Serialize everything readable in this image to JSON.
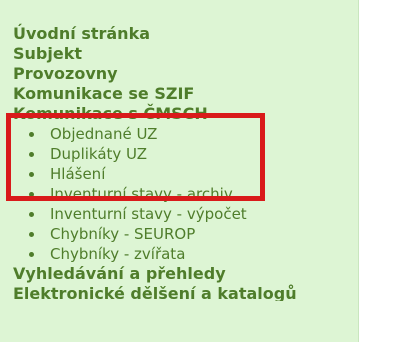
{
  "menu": {
    "headings": [
      "Úvodní stránka",
      "Subjekt",
      "Provozovny",
      "Komunikace se SZIF",
      "Komunikace s ČMSCH"
    ],
    "items": [
      "Objednané UZ",
      "Duplikáty UZ",
      "Hlášení",
      "Inventurní stavy - archiv",
      "Inventurní stavy - výpočet",
      "Chybníky - SEUROP",
      "Chybníky - zvířata"
    ],
    "footer_heading": "Vyhledávání a přehledy",
    "cut_heading": "Elektronické dělšení a katalogů"
  },
  "highlight": {
    "color": "#d91a1a",
    "covers": [
      "Komunikace s ČMSCH",
      "Objednané UZ",
      "Duplikáty UZ"
    ]
  }
}
